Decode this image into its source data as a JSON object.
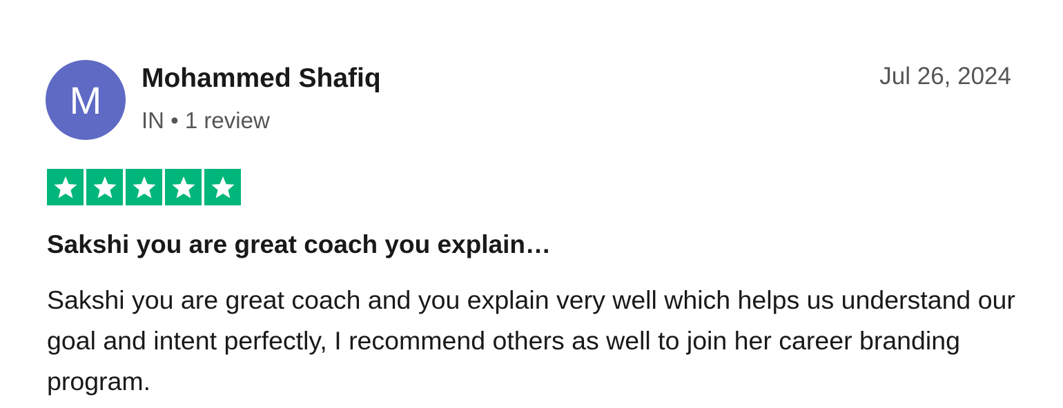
{
  "review": {
    "avatar_initial": "M",
    "reviewer_name": "Mohammed Shafiq",
    "reviewer_meta": "IN • 1 review",
    "date": "Jul 26, 2024",
    "rating": 5,
    "rating_max": 5,
    "title": "Sakshi you are great coach you explain…",
    "body": "Sakshi you are great coach and you explain very well which helps us understand our goal and intent perfectly, I recommend others as well to join her career branding program."
  },
  "colors": {
    "avatar": "#5f6ac4",
    "star_fill": "#00b67a",
    "text": "#191919",
    "muted": "#555555"
  },
  "icons": {
    "star": "star-icon"
  }
}
